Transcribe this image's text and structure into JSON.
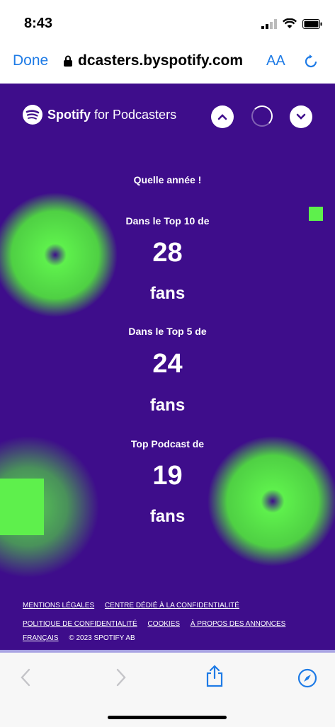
{
  "status": {
    "time": "8:43"
  },
  "browser": {
    "done_label": "Done",
    "url": "dcasters.byspotify.com",
    "text_size_label": "AA"
  },
  "header": {
    "brand": "Spotify",
    "brand_suffix": "for Podcasters"
  },
  "stats": {
    "intro": "Quelle année !",
    "top10_label": "Dans le Top 10 de",
    "top10_value": "28",
    "top5_label": "Dans le Top 5 de",
    "top5_value": "24",
    "top1_label": "Top Podcast de",
    "top1_value": "19",
    "unit": "fans"
  },
  "footer": {
    "legal": "MENTIONS LÉGALES",
    "privacy_center": "CENTRE DÉDIÉ À LA CONFIDENTIALITÉ",
    "privacy_policy": "POLITIQUE DE CONFIDENTIALITÉ",
    "cookies": "COOKIES",
    "about_ads": "À PROPOS DES ANNONCES",
    "language": "FRANÇAIS",
    "copyright": "© 2023 SPOTIFY AB"
  },
  "colors": {
    "background": "#3e0d8b",
    "accent": "#5ef04c",
    "link": "#1e7be6"
  },
  "icons": [
    "lock-icon",
    "reload-icon",
    "chevron-up-icon",
    "chevron-down-icon",
    "back-icon",
    "forward-icon",
    "share-icon",
    "compass-icon"
  ]
}
